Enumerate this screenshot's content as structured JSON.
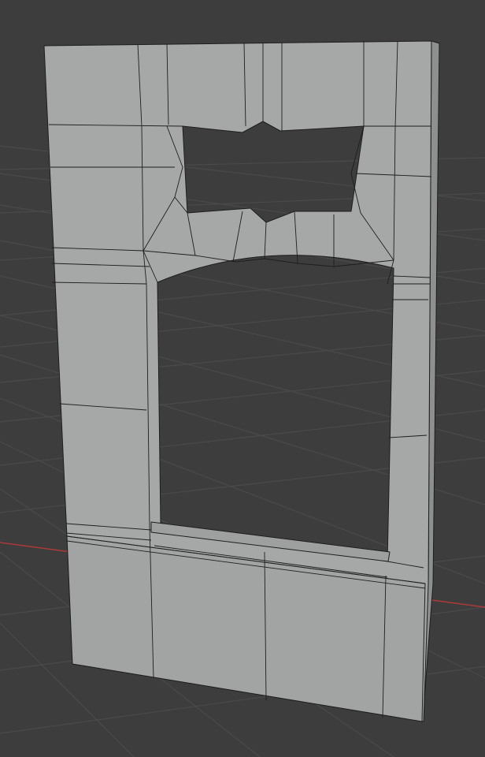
{
  "viewport": {
    "background_color": "#3d3d3d",
    "grid_color": "#4a4a4a",
    "x_axis_color": "#a83a3a",
    "mesh_face_color": "#a6a8a8",
    "mesh_side_color": "#8e9090",
    "mesh_edge_color": "#1e1e1e"
  }
}
